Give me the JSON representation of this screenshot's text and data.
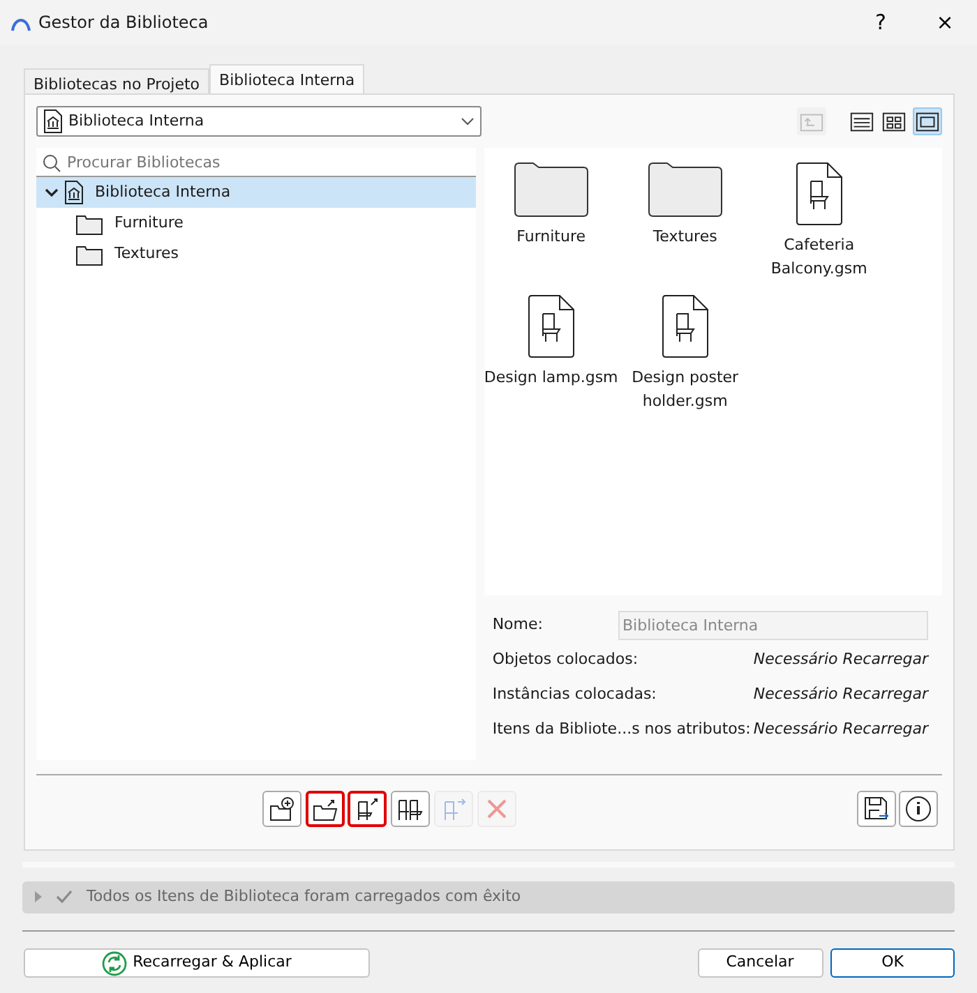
{
  "window": {
    "title": "Gestor da Biblioteca",
    "help": "?",
    "close": "×"
  },
  "tabs": [
    {
      "label": "Bibliotecas no Projeto",
      "selected": false
    },
    {
      "label": "Biblioteca Interna",
      "selected": true
    }
  ],
  "library_dropdown": {
    "value": "Biblioteca Interna"
  },
  "view_buttons": [
    {
      "kind": "up",
      "selected": false,
      "disabled": true
    },
    {
      "kind": "list",
      "selected": false,
      "disabled": false
    },
    {
      "kind": "grid",
      "selected": false,
      "disabled": false
    },
    {
      "kind": "large",
      "selected": true,
      "disabled": false
    }
  ],
  "search": {
    "placeholder": "Procurar Bibliotecas"
  },
  "tree": [
    {
      "label": "Biblioteca Interna",
      "kind": "library",
      "selected": true,
      "expanded": true,
      "children": [
        {
          "label": "Furniture",
          "kind": "folder",
          "selected": false
        },
        {
          "label": "Textures",
          "kind": "folder",
          "selected": false
        }
      ]
    }
  ],
  "items": [
    {
      "label": "Furniture",
      "kind": "folder"
    },
    {
      "label": "Textures",
      "kind": "folder"
    },
    {
      "label": "Cafeteria Balcony.gsm",
      "kind": "object"
    },
    {
      "label": "Design lamp.gsm",
      "kind": "object"
    },
    {
      "label": "Design poster holder.gsm",
      "kind": "object"
    }
  ],
  "details": {
    "name_label": "Nome:",
    "name_value": "Biblioteca Interna",
    "rows": [
      {
        "label": "Objetos colocados:",
        "value": "Necessário Recarregar"
      },
      {
        "label": "Instâncias colocadas:",
        "value": "Necessário Recarregar"
      },
      {
        "label": "Itens da Bibliote...s nos atributos:",
        "value": "Necessário Recarregar"
      }
    ]
  },
  "toolbar": [
    {
      "kind": "add-folder",
      "highlighted": false,
      "disabled": false
    },
    {
      "kind": "export-folder",
      "highlighted": true,
      "disabled": false
    },
    {
      "kind": "export-object",
      "highlighted": true,
      "disabled": false
    },
    {
      "kind": "objects",
      "highlighted": false,
      "disabled": false
    },
    {
      "kind": "move-object",
      "highlighted": false,
      "disabled": true
    },
    {
      "kind": "delete",
      "highlighted": false,
      "disabled": true
    }
  ],
  "toolbar_right": [
    {
      "kind": "save"
    },
    {
      "kind": "info"
    }
  ],
  "status": {
    "text": "Todos os Itens de Biblioteca foram carregados com êxito",
    "expanded": false
  },
  "buttons": {
    "reload": "Recarregar & Aplicar",
    "cancel": "Cancelar",
    "ok": "OK"
  }
}
